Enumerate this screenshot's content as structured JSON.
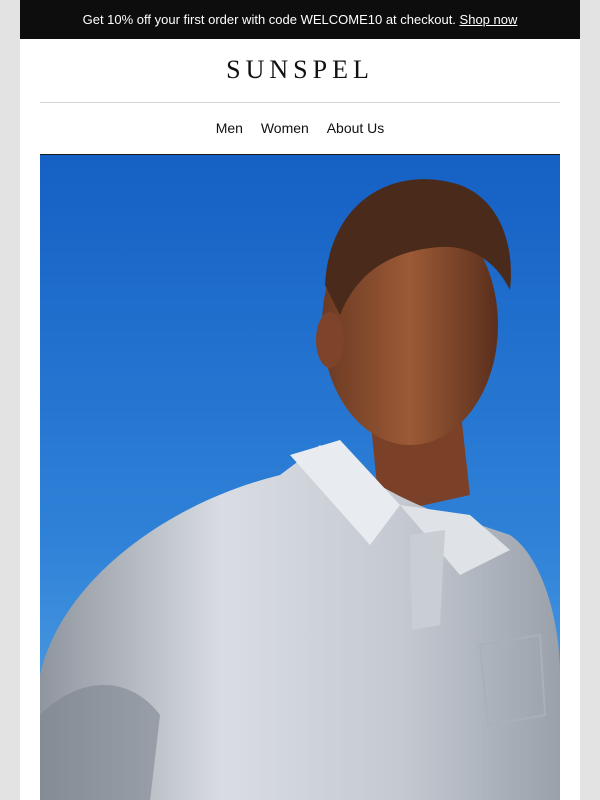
{
  "promo": {
    "text": "Get 10% off your first order with code WELCOME10 at checkout.",
    "link_label": "Shop now"
  },
  "brand": {
    "logo": "SUNSPEL"
  },
  "nav": {
    "items": [
      {
        "label": "Men"
      },
      {
        "label": "Women"
      },
      {
        "label": "About Us"
      }
    ]
  },
  "hero": {
    "image": "man-in-white-polo-against-blue-sky"
  },
  "colors": {
    "promo_bg": "#0d0d0d",
    "sky_top": "#1560c4",
    "sky_bottom": "#5aa6e6",
    "background": "#e3e3e3"
  }
}
